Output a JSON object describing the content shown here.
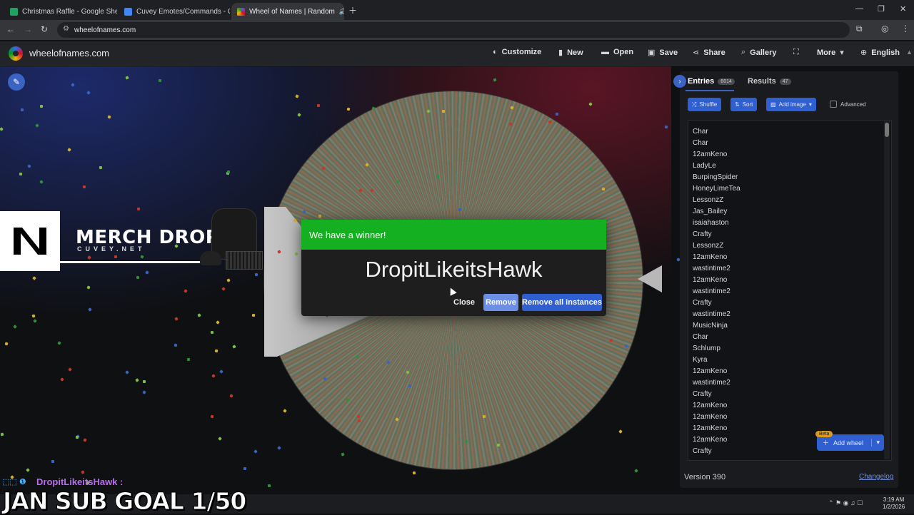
{
  "browser": {
    "tabs": [
      {
        "title": "Christmas Raffle - Google Shee",
        "color": "#1ea362"
      },
      {
        "title": "Cuvey Emotes/Commands - Go",
        "color": "#4285f4"
      },
      {
        "title": "Wheel of Names | Random",
        "color": "#d50f25"
      }
    ],
    "url": "wheelofnames.com"
  },
  "site": {
    "brand": "wheelofnames.com",
    "nav": [
      {
        "label": "Customize",
        "icon": "palette-icon"
      },
      {
        "label": "New",
        "icon": "file-icon"
      },
      {
        "label": "Open",
        "icon": "folder-icon"
      },
      {
        "label": "Save",
        "icon": "save-icon"
      },
      {
        "label": "Share",
        "icon": "share-icon"
      },
      {
        "label": "Gallery",
        "icon": "search-icon"
      },
      {
        "label": "",
        "icon": "fullscreen-icon"
      },
      {
        "label": "More",
        "icon": "chevron-down-icon"
      },
      {
        "label": "English",
        "icon": "globe-icon"
      }
    ]
  },
  "merch": {
    "title": "MERCH DROP",
    "subtitle": "CUVEY.NET"
  },
  "dialog": {
    "header": "We have a winner!",
    "winner": "DropitLikeitsHawk",
    "close": "Close",
    "remove": "Remove",
    "remove_all": "Remove all instances"
  },
  "panel": {
    "entries_tab": "Entries",
    "entries_count": "6014",
    "results_tab": "Results",
    "results_count": "47",
    "shuffle": "Shuffle",
    "sort": "Sort",
    "add_image": "Add image",
    "advanced": "Advanced",
    "entries": [
      "Char",
      "Char",
      "12amKeno",
      "LadyLe",
      "BurpingSpider",
      "HoneyLimeTea",
      "LessonzZ",
      "Jas_Bailey",
      "isaiahaston",
      "Crafty",
      "LessonzZ",
      "12amKeno",
      "wastintime2",
      "12amKeno",
      "wastintime2",
      "Crafty",
      "wastintime2",
      "MusicNinja",
      "Char",
      "Schlump",
      "Kyra",
      "12amKeno",
      "wastintime2",
      "Crafty",
      "12amKeno",
      "12amKeno",
      "12amKeno",
      "12amKeno",
      "Crafty"
    ],
    "add_wheel": "Add wheel",
    "beta": "Beta",
    "version": "Version 390",
    "changelog": "Changelog"
  },
  "stream": {
    "chat_user": "DropitLikeitsHawk :",
    "sub_goal": "JAN SUB GOAL 1/50"
  },
  "taskbar": {
    "time": "3:19 AM",
    "date": "1/2/2026"
  },
  "colors": {
    "accent": "#2f5fd0",
    "winner_green": "#14b022"
  }
}
